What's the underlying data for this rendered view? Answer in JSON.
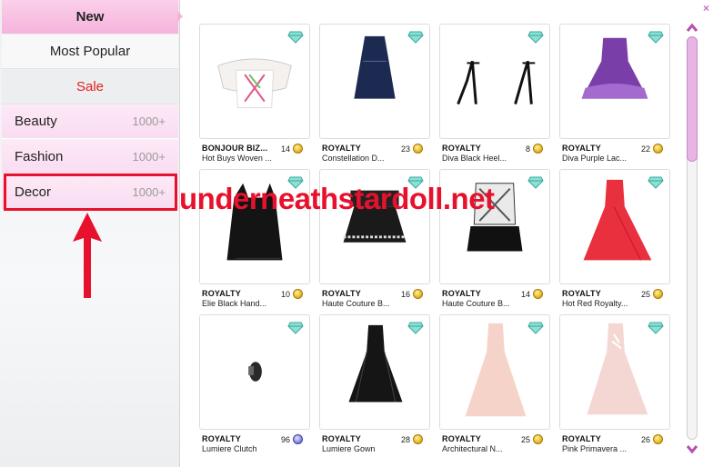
{
  "sidebar": {
    "new": "New",
    "most_popular": "Most Popular",
    "sale": "Sale",
    "categories": [
      {
        "label": "Beauty",
        "count": "1000+"
      },
      {
        "label": "Fashion",
        "count": "1000+"
      },
      {
        "label": "Decor",
        "count": "1000+"
      }
    ]
  },
  "watermark": "underneathstardoll.net",
  "close_icon": "×",
  "colors": {
    "accent_pink": "#f5b3dc",
    "category_pink": "#fbe2f4",
    "sale_red": "#e02020",
    "annotation_red": "#e8112d",
    "scroll_thumb": "#e8b4e4"
  },
  "items": [
    {
      "brand": "BONJOUR BIZ...",
      "name": "Hot Buys Woven ...",
      "price": "14",
      "currency": "coin",
      "icon": "gem-icon"
    },
    {
      "brand": "ROYALTY",
      "name": "Constellation D...",
      "price": "23",
      "currency": "coin",
      "icon": "gem-icon"
    },
    {
      "brand": "ROYALTY",
      "name": "Diva Black Heel...",
      "price": "8",
      "currency": "coin",
      "icon": "gem-icon"
    },
    {
      "brand": "ROYALTY",
      "name": "Diva Purple Lac...",
      "price": "22",
      "currency": "coin",
      "icon": "gem-icon"
    },
    {
      "brand": "ROYALTY",
      "name": "Elie Black Hand...",
      "price": "10",
      "currency": "coin",
      "icon": "gem-icon"
    },
    {
      "brand": "ROYALTY",
      "name": "Haute Couture B...",
      "price": "16",
      "currency": "coin",
      "icon": "gem-icon"
    },
    {
      "brand": "ROYALTY",
      "name": "Haute Couture B...",
      "price": "14",
      "currency": "coin",
      "icon": "gem-icon"
    },
    {
      "brand": "ROYALTY",
      "name": "Hot Red Royalty...",
      "price": "25",
      "currency": "coin",
      "icon": "gem-icon"
    },
    {
      "brand": "ROYALTY",
      "name": "Lumiere Clutch",
      "price": "96",
      "currency": "stardollar",
      "icon": "gem-icon"
    },
    {
      "brand": "ROYALTY",
      "name": "Lumiere Gown",
      "price": "28",
      "currency": "coin",
      "icon": "gem-icon"
    },
    {
      "brand": "ROYALTY",
      "name": "Architectural N...",
      "price": "25",
      "currency": "coin",
      "icon": "gem-icon"
    },
    {
      "brand": "ROYALTY",
      "name": "Pink Primavera ...",
      "price": "26",
      "currency": "coin",
      "icon": "gem-icon"
    }
  ]
}
